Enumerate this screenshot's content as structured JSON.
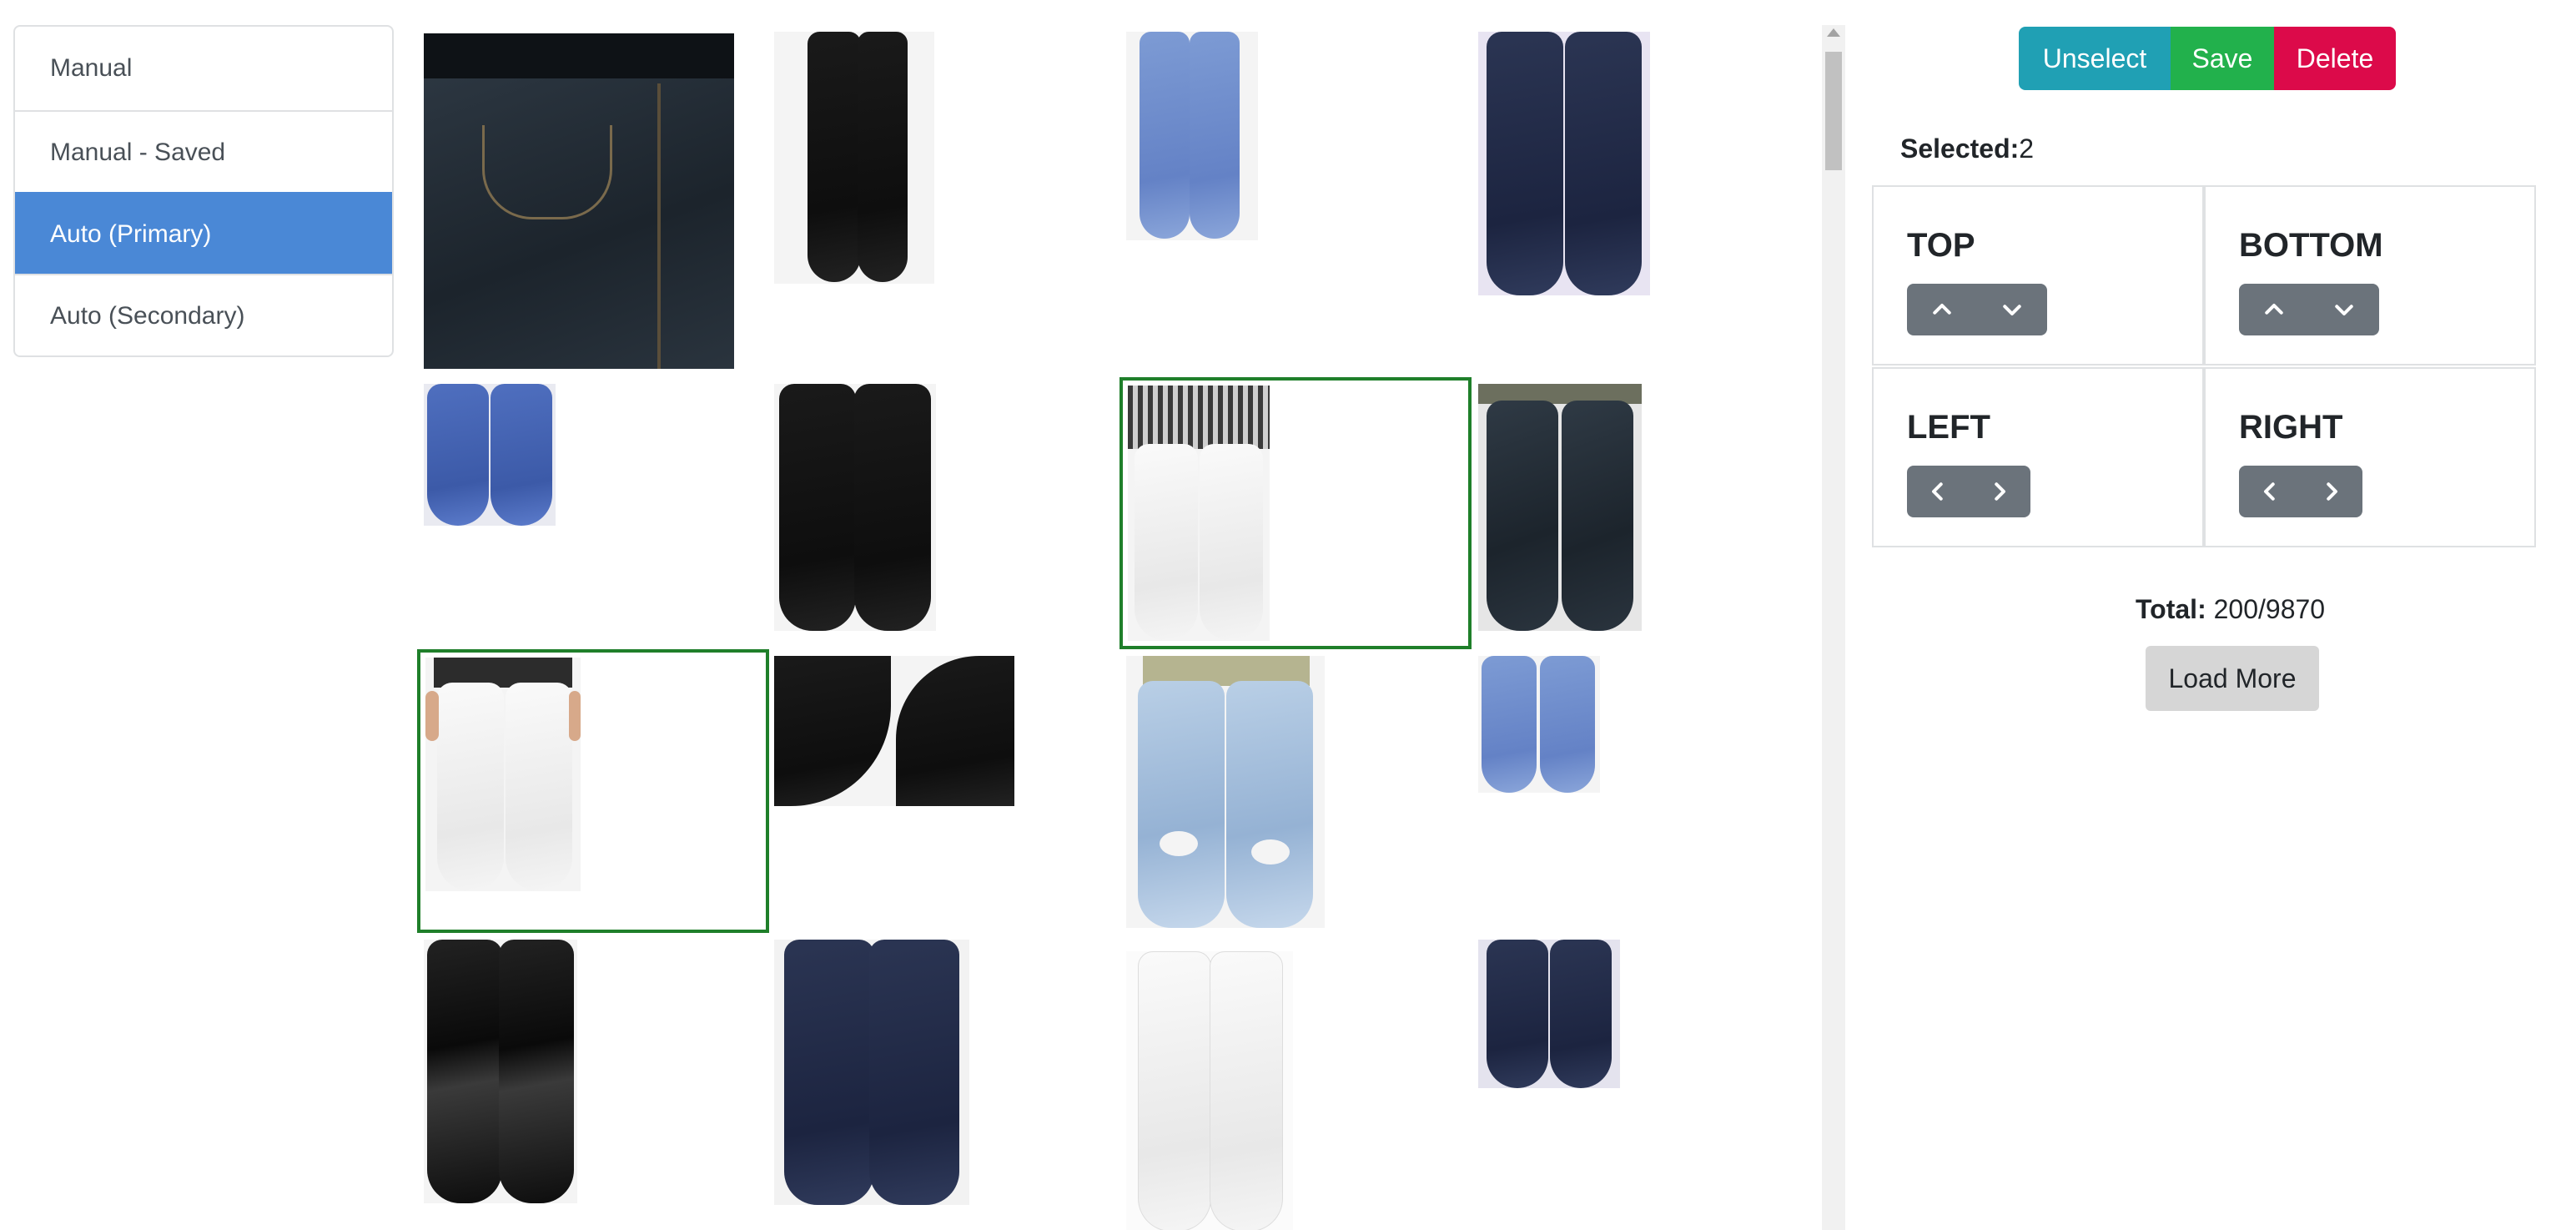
{
  "nav": {
    "items": [
      {
        "label": "Manual",
        "active": false
      },
      {
        "label": "Manual - Saved",
        "active": false
      },
      {
        "label": "Auto (Primary)",
        "active": true
      },
      {
        "label": "Auto (Secondary)",
        "active": false
      }
    ]
  },
  "toolbar": {
    "unselect_label": "Unselect",
    "save_label": "Save",
    "delete_label": "Delete"
  },
  "selection": {
    "label": "Selected:",
    "count": "2"
  },
  "directions": {
    "top": {
      "label": "TOP",
      "buttons": [
        "chevron-up-icon",
        "chevron-down-icon"
      ]
    },
    "bottom": {
      "label": "BOTTOM",
      "buttons": [
        "chevron-up-icon",
        "chevron-down-icon"
      ]
    },
    "left": {
      "label": "LEFT",
      "buttons": [
        "chevron-left-icon",
        "chevron-right-icon"
      ]
    },
    "right": {
      "label": "RIGHT",
      "buttons": [
        "chevron-left-icon",
        "chevron-right-icon"
      ]
    }
  },
  "totals": {
    "label": "Total:",
    "value": "200/9870"
  },
  "load_more_label": "Load More",
  "grid": {
    "images": [
      {
        "style": "dark denim pocket closeup",
        "selected": false
      },
      {
        "style": "black skinny jeans",
        "selected": false
      },
      {
        "style": "light blue skinny jeans",
        "selected": false
      },
      {
        "style": "dark navy jeans back",
        "selected": false
      },
      {
        "style": "blue jeans",
        "selected": false
      },
      {
        "style": "black high-waist jeans",
        "selected": true
      },
      {
        "style": "white jeans with fringe",
        "selected": true
      },
      {
        "style": "black straight jeans",
        "selected": false
      },
      {
        "style": "white jeans",
        "selected": true
      },
      {
        "style": "black leggings closeup",
        "selected": false
      },
      {
        "style": "ripped light wash jeans",
        "selected": false
      },
      {
        "style": "light blue cropped jeans",
        "selected": false
      },
      {
        "style": "black leather leggings",
        "selected": false
      },
      {
        "style": "dark wash jeans",
        "selected": false
      },
      {
        "style": "white studded jeans",
        "selected": false
      },
      {
        "style": "navy slim jeans",
        "selected": false
      }
    ]
  },
  "colors": {
    "nav_active": "#4a88d6",
    "unselect": "#20a0b4",
    "save": "#22b14c",
    "delete": "#dc0a4a",
    "arrow_group": "#6b737b",
    "selection_border": "#1f7f2a"
  }
}
